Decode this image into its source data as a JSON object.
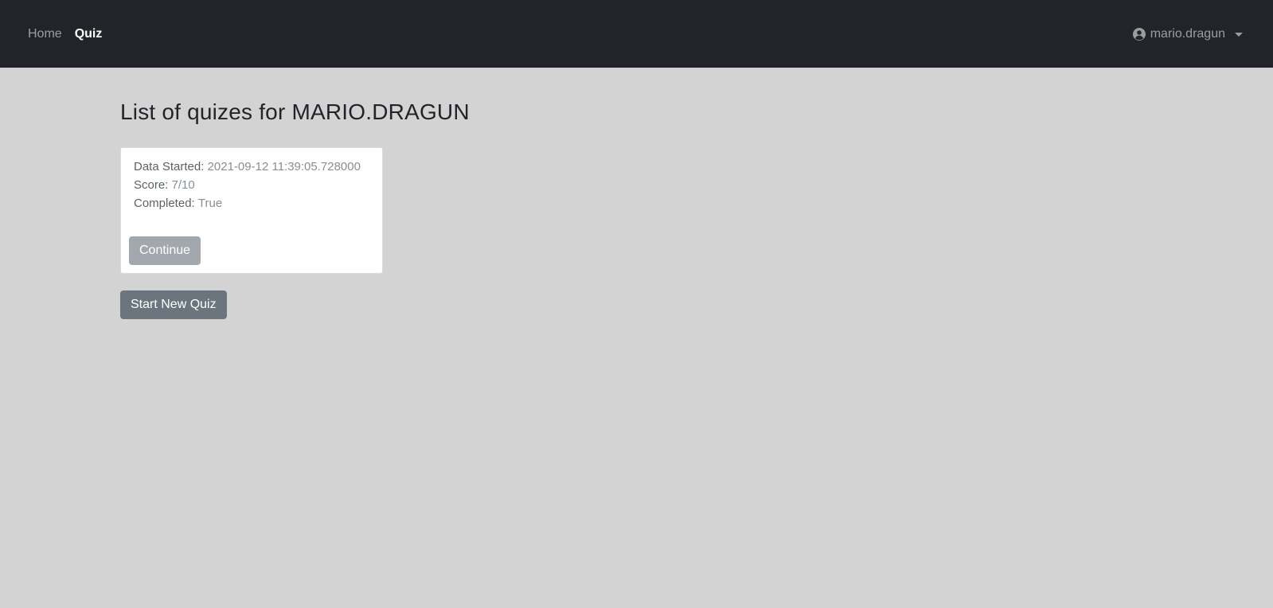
{
  "nav": {
    "home_label": "Home",
    "quiz_label": "Quiz",
    "user_label": "mario.dragun",
    "user_icon": "user-circle-icon"
  },
  "main": {
    "title_prefix": "List of quizes for",
    "title_username": "MARIO.DRAGUN",
    "quizzes": [
      {
        "date_label": "Data Started:",
        "date_value": "2021-09-12 11:39:05.728000",
        "score_label": "Score:",
        "score_value": "7/10",
        "completed_label": "Completed:",
        "completed_value": "True",
        "continue_label": "Continue"
      }
    ],
    "start_new_label": "Start New Quiz"
  },
  "colors": {
    "navbar_bg": "#212529",
    "page_bg": "#d3d3d3",
    "continue_btn": "#a3a8ae",
    "start_btn": "#6c757d"
  }
}
